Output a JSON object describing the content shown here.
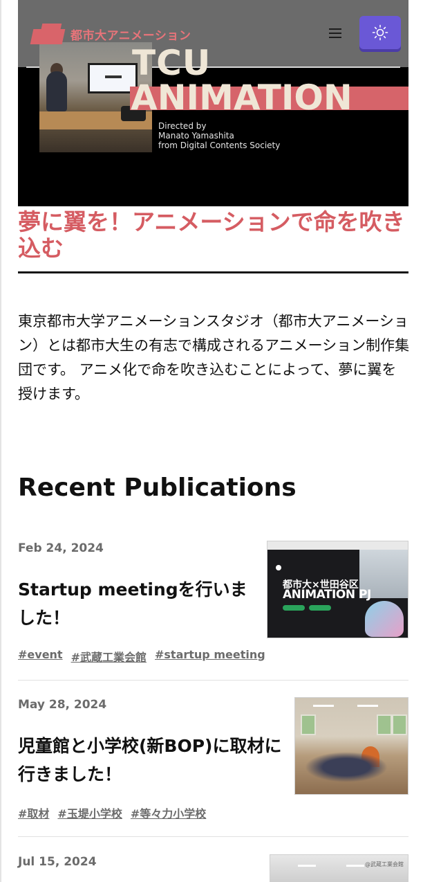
{
  "hero": {
    "logo_text": "都市大アニメーション",
    "title_line1": "TCU",
    "title_line2": "ANIMATION",
    "credit_line1": "Directed by",
    "credit_line2": "Manato Yamashita",
    "credit_line3": "from Digital Contents Society",
    "menu_icon": "hamburger-icon",
    "theme_icon": "sun-icon",
    "colors": {
      "accent": "#d6646a",
      "theme_button": "#6a58d6",
      "title": "#efe6d6"
    }
  },
  "headline": "夢に翼を！アニメーションで命を吹き込む",
  "intro": "東京都市大学アニメーションスタジオ（都市大アニメーション）とは都市大生の有志で構成されるアニメーション制作集団です。 アニメ化で命を吹き込むことによって、夢に翼を授けます。",
  "recent": {
    "title": "Recent Publications",
    "posts": [
      {
        "date": "Feb 24, 2024",
        "title": "Startup meetingを行いました！",
        "tags": [
          "#event",
          "#武蔵工業会館",
          "#startup meeting"
        ],
        "thumb": {
          "heading_small": "都市大×世田谷区",
          "heading_large": "ANIMATION PJ"
        }
      },
      {
        "date": "May 28, 2024",
        "title": "児童館と小学校(新BOP)に取材に行きました！",
        "tags": [
          "#取材",
          "#玉堤小学校",
          "#等々力小学校"
        ],
        "thumb": {}
      },
      {
        "date": "Jul 15, 2024",
        "title": "",
        "tags": [],
        "thumb": {
          "watermark": "@武蔵工業会館"
        }
      }
    ]
  }
}
